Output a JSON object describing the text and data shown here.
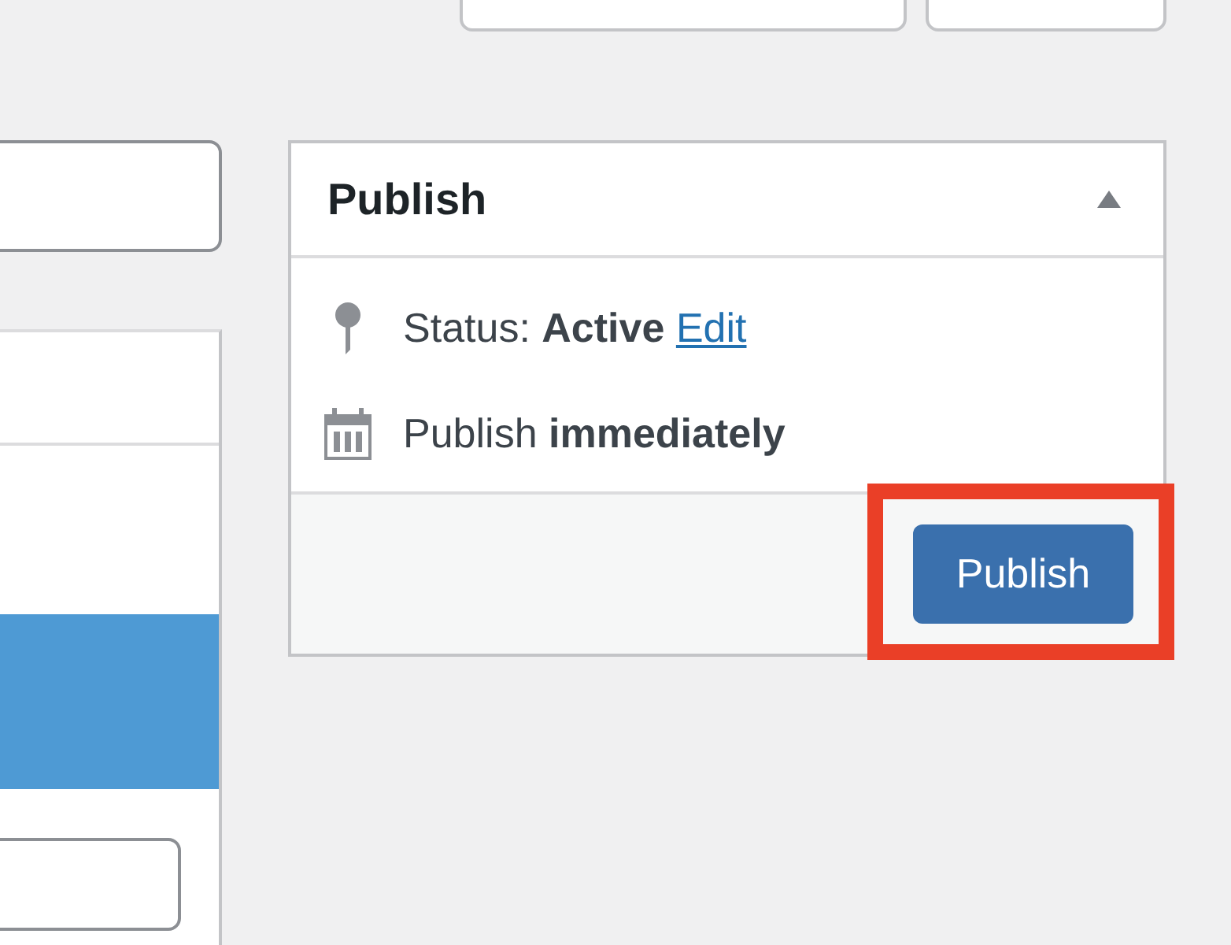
{
  "left_list": {
    "rows": [
      {
        "selected": true
      }
    ]
  },
  "publish_box": {
    "title": "Publish",
    "expanded": true,
    "rows": [
      {
        "kind": "status",
        "text": "Status: **Active**",
        "link": "Edit"
      },
      {
        "kind": "schedule",
        "text": "Publish **immediately**"
      }
    ],
    "button": {
      "label": "Publish",
      "highlighted": true
    }
  }
}
